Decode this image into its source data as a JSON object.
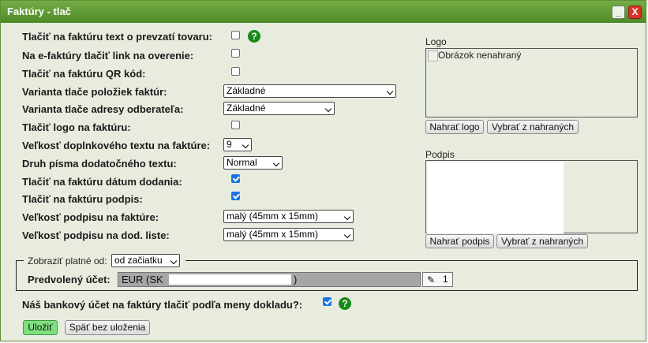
{
  "window": {
    "title": "Faktúry - tlač",
    "minimize_label": "_",
    "close_label": "X"
  },
  "settings": [
    {
      "label": "Tlačiť na faktúru text o prevzatí tovaru:",
      "checked": false,
      "help": true
    },
    {
      "label": "Na e-faktúry tlačiť link na overenie:",
      "checked": false
    },
    {
      "label": "Tlačiť na faktúru QR kód:",
      "checked": false
    },
    {
      "label": "Varianta tlače položiek faktúr:",
      "select": "Základné"
    },
    {
      "label": "Varianta tlače adresy odberateľa:",
      "select": "Základné"
    },
    {
      "label": "Tlačiť logo na faktúru:",
      "checked": false
    },
    {
      "label": "Veľkosť doplnkového textu na faktúre:",
      "select": "9"
    },
    {
      "label": "Druh písma dodatočného textu:",
      "select": "Normal"
    },
    {
      "label": "Tlačiť na faktúru dátum dodania:",
      "checked": true
    },
    {
      "label": "Tlačiť na faktúru podpis:",
      "checked": true
    },
    {
      "label": "Veľkosť podpisu na faktúre:",
      "select": "malý (45mm x 15mm)"
    },
    {
      "label": "Veľkosť podpisu na dod. liste:",
      "select": "malý (45mm x 15mm)"
    }
  ],
  "help_glyph": "?",
  "logo": {
    "label": "Logo",
    "placeholder": "Obrázok nenahraný",
    "upload_button": "Nahrať logo",
    "choose_button": "Vybrať z nahraných"
  },
  "signature": {
    "label": "Podpis",
    "upload_button": "Nahrať podpis",
    "choose_button": "Vybrať z nahraných"
  },
  "validity": {
    "legend_label": "Zobraziť platné od:",
    "select": "od začiatku"
  },
  "account": {
    "label": "Predvolený účet:",
    "value_prefix": "EUR (SK",
    "value_suffix": ")",
    "count": "1",
    "edit_icon": "pencil-icon"
  },
  "bank_setting": {
    "label": "Náš bankový účet na faktúry tlačiť podľa meny dokladu?:",
    "checked": true
  },
  "actions": {
    "save": "Uložiť",
    "back": "Späť bez uloženia"
  },
  "colors": {
    "titlebar": "#5c9a31",
    "dialog_bg": "#e7ecdf",
    "checkbox_on": "#1a73e8",
    "help": "#178a19",
    "save_button": "#7fe07f",
    "close_button": "#d9342b"
  }
}
